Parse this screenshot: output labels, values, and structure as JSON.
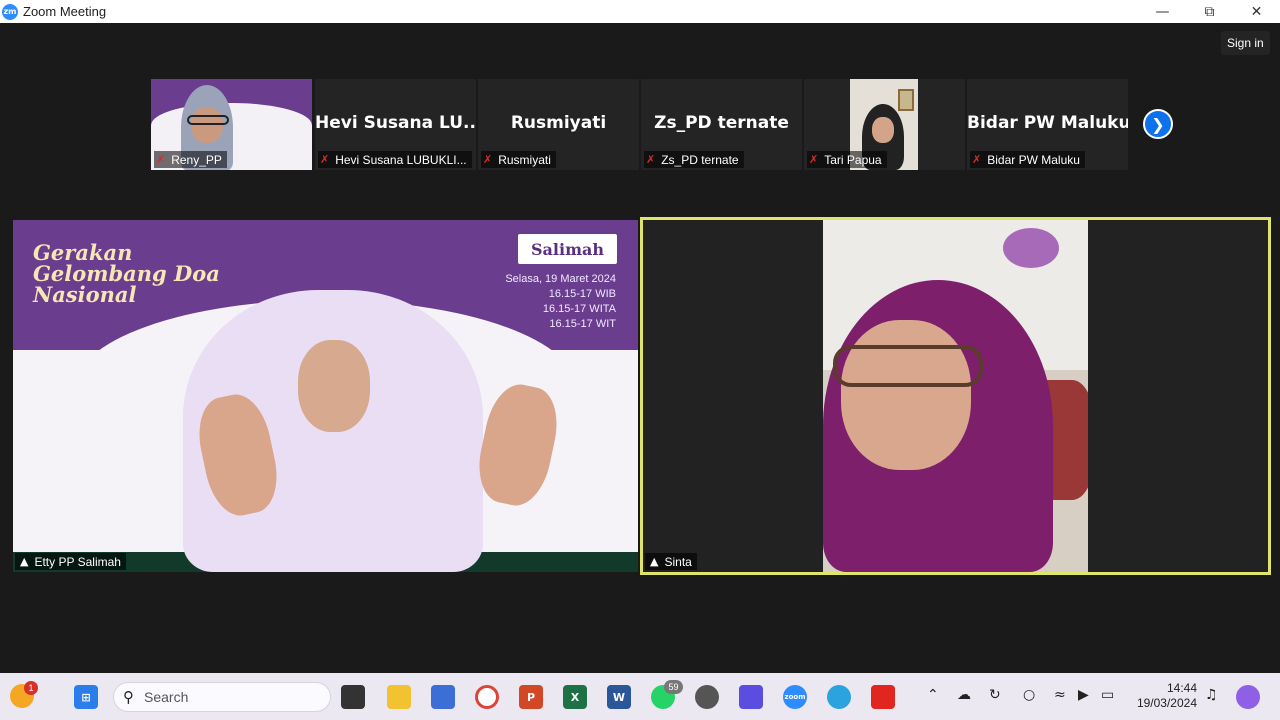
{
  "window": {
    "title": "Zoom Meeting",
    "app_logo": "zm",
    "minimize_icon": "minimize-icon",
    "maximize_icon": "restore-icon",
    "close_icon": "close-icon"
  },
  "header": {
    "signin_label": "Sign in"
  },
  "thumbnails": [
    {
      "name": "Reny_PP",
      "display": "",
      "muted": true,
      "video": true
    },
    {
      "name": "Hevi Susana LUBUKLI...",
      "display": "Hevi Susana LU...",
      "muted": true,
      "video": false
    },
    {
      "name": "Rusmiyati",
      "display": "Rusmiyati",
      "muted": true,
      "video": false
    },
    {
      "name": "Zs_PD ternate",
      "display": "Zs_PD ternate",
      "muted": true,
      "video": false
    },
    {
      "name": "Tari Papua",
      "display": "",
      "muted": true,
      "video": true
    },
    {
      "name": "Bidar PW Maluku",
      "display": "Bidar PW Maluku",
      "muted": true,
      "video": false
    }
  ],
  "next_page_icon": "chevron-right-icon",
  "speaker_left": {
    "name": "Etty PP Salimah",
    "banner_title": "Gerakan\nGelombang Doa\nNasional",
    "banner_logo": "Salimah",
    "banner_date": "Selasa, 19 Maret 2024\n16.15-17 WIB\n16.15-17 WITA\n16.15-17 WIT"
  },
  "speaker_right": {
    "name": "Sinta",
    "active_speaker_color": "#dfe56a"
  },
  "taskbar": {
    "weather_badge": "1",
    "search_placeholder": "Search",
    "whatsapp_badge": "59",
    "time": "14:44",
    "date": "19/03/2024",
    "apps": [
      "windows-start-icon",
      "search-icon",
      "task-view-icon",
      "file-explorer-icon",
      "store-icon",
      "chrome-icon",
      "powerpoint-icon",
      "excel-icon",
      "word-icon",
      "whatsapp-icon",
      "app-icon",
      "edit-icon",
      "zoom-icon",
      "telegram-icon",
      "pdf-icon"
    ],
    "tray": [
      "chevron-up-icon",
      "onedrive-icon",
      "sync-icon",
      "microphone-icon",
      "wifi-icon",
      "volume-icon",
      "battery-icon",
      "notification-bell-icon",
      "copilot-icon"
    ]
  },
  "colors": {
    "zoom_blue": "#0e72ed",
    "background": "#1a1a1a",
    "tile_bg": "#242424",
    "muted_red": "#e02828",
    "banner_purple": "#6b3d8f"
  }
}
